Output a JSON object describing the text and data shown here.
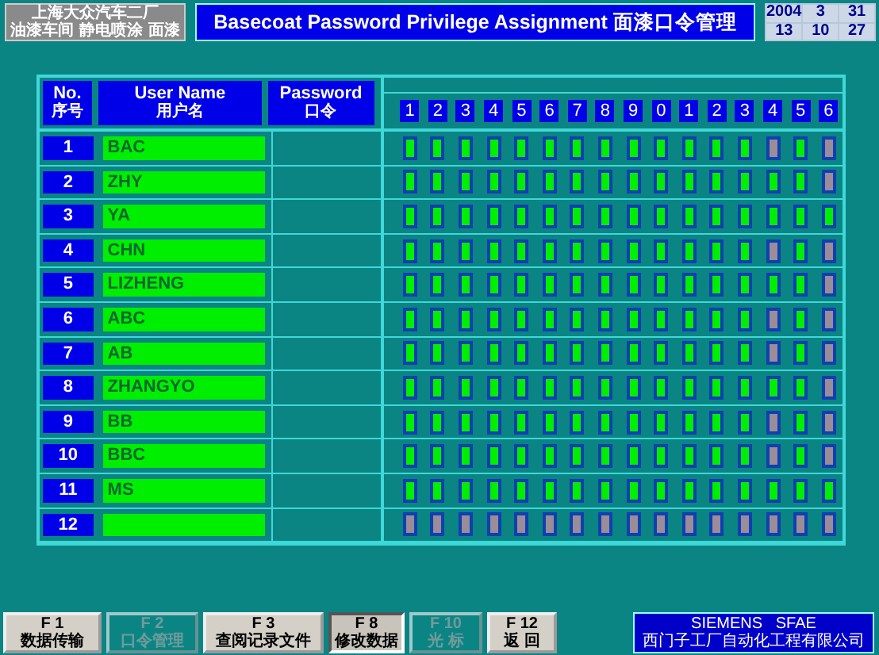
{
  "header": {
    "plant_line_1": "上海大众汽车二厂",
    "plant_line_2": "油漆车间 静电喷涂 面漆",
    "title": "Basecoat Password Privilege Assignment 面漆口令管理",
    "date": {
      "year": "2004",
      "month": "3",
      "day": "31",
      "hour": "13",
      "minute": "10",
      "second": "27"
    }
  },
  "table": {
    "columns": [
      {
        "en": "No.",
        "zh": "序号"
      },
      {
        "en": "User Name",
        "zh": "用户名"
      },
      {
        "en": "Password",
        "zh": "口令"
      }
    ],
    "privilege_columns": [
      "1",
      "2",
      "3",
      "4",
      "5",
      "6",
      "7",
      "8",
      "9",
      "0",
      "1",
      "2",
      "3",
      "4",
      "5",
      "6"
    ],
    "rows": [
      {
        "no": "1",
        "name": "BAC",
        "rights": [
          true,
          true,
          true,
          true,
          true,
          true,
          true,
          true,
          true,
          true,
          true,
          true,
          true,
          false,
          true,
          false
        ]
      },
      {
        "no": "2",
        "name": "ZHY",
        "rights": [
          true,
          true,
          true,
          true,
          true,
          true,
          true,
          true,
          true,
          true,
          true,
          true,
          true,
          true,
          true,
          false
        ]
      },
      {
        "no": "3",
        "name": "YA",
        "rights": [
          true,
          true,
          true,
          true,
          true,
          true,
          true,
          true,
          true,
          true,
          true,
          true,
          true,
          true,
          true,
          true
        ]
      },
      {
        "no": "4",
        "name": "CHN",
        "rights": [
          true,
          true,
          true,
          true,
          true,
          true,
          true,
          true,
          true,
          true,
          true,
          true,
          true,
          false,
          true,
          false
        ]
      },
      {
        "no": "5",
        "name": "LIZHENG",
        "rights": [
          true,
          true,
          true,
          true,
          true,
          true,
          true,
          true,
          true,
          true,
          true,
          true,
          true,
          true,
          true,
          false
        ]
      },
      {
        "no": "6",
        "name": "ABC",
        "rights": [
          true,
          true,
          true,
          true,
          true,
          true,
          true,
          true,
          true,
          true,
          true,
          true,
          true,
          false,
          true,
          false
        ]
      },
      {
        "no": "7",
        "name": "AB",
        "rights": [
          true,
          true,
          true,
          true,
          true,
          true,
          true,
          true,
          true,
          true,
          true,
          true,
          true,
          false,
          true,
          false
        ]
      },
      {
        "no": "8",
        "name": "ZHANGYO",
        "rights": [
          true,
          true,
          true,
          true,
          true,
          true,
          true,
          true,
          true,
          true,
          true,
          true,
          true,
          true,
          true,
          false
        ]
      },
      {
        "no": "9",
        "name": "BB",
        "rights": [
          true,
          true,
          true,
          true,
          true,
          true,
          true,
          true,
          true,
          true,
          true,
          true,
          true,
          false,
          true,
          false
        ]
      },
      {
        "no": "10",
        "name": "BBC",
        "rights": [
          true,
          true,
          true,
          true,
          true,
          true,
          true,
          true,
          true,
          true,
          true,
          true,
          true,
          false,
          true,
          false
        ]
      },
      {
        "no": "11",
        "name": "MS",
        "rights": [
          true,
          true,
          true,
          true,
          true,
          true,
          true,
          true,
          true,
          true,
          true,
          true,
          true,
          true,
          true,
          true
        ]
      },
      {
        "no": "12",
        "rights": [
          false,
          false,
          false,
          false,
          false,
          false,
          false,
          false,
          false,
          false,
          false,
          false,
          false,
          false,
          false,
          false
        ]
      }
    ]
  },
  "function_keys": [
    {
      "key": "F 1",
      "label": "数据传输",
      "disabled": false,
      "pressed": false
    },
    {
      "key": "F 2",
      "label": "口令管理",
      "disabled": true,
      "pressed": false
    },
    {
      "key": "F 3",
      "label": "查阅记录文件",
      "disabled": false,
      "pressed": false
    },
    {
      "key": "F 8",
      "label": "修改数据",
      "disabled": false,
      "pressed": true
    },
    {
      "key": "F 10",
      "label": "光 标",
      "disabled": true,
      "pressed": false
    },
    {
      "key": "F 12",
      "label": "返 回",
      "disabled": false,
      "pressed": false
    }
  ],
  "vendor": {
    "name": "SIEMENS   SFAE",
    "company": "西门子工厂自动化工程有限公司"
  }
}
